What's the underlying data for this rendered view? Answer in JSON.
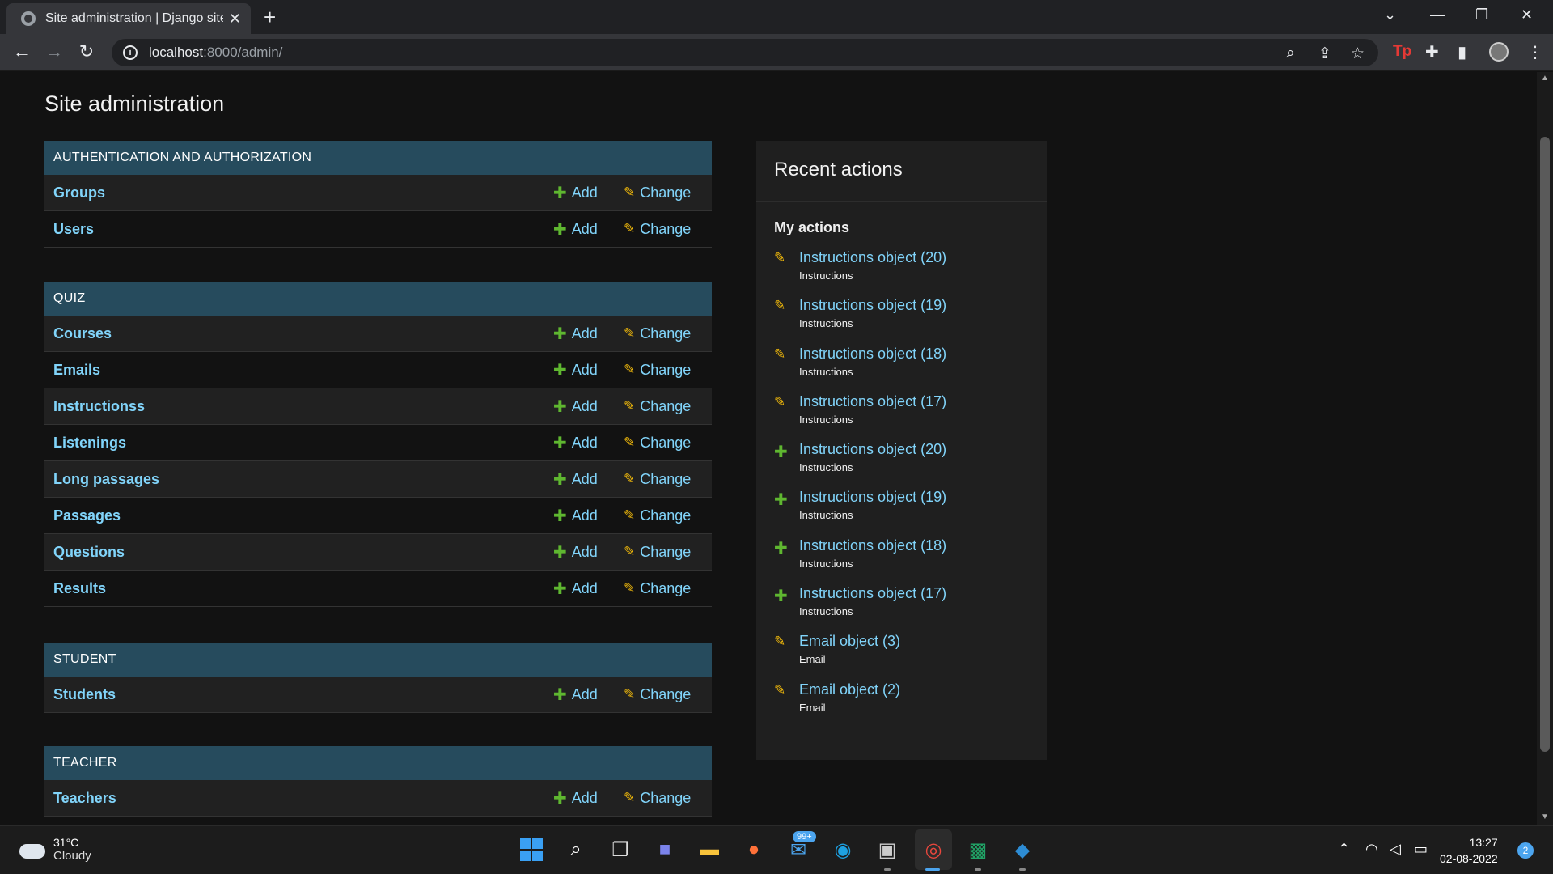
{
  "browser": {
    "tab_title": "Site administration | Django site admin",
    "tab_close": "✕",
    "new_tab": "+",
    "url_host": "localhost",
    "url_path": ":8000/admin/"
  },
  "page": {
    "title": "Site administration",
    "add_label": "Add",
    "change_label": "Change",
    "modules": [
      {
        "caption": "Authentication and Authorization",
        "models": [
          "Groups",
          "Users"
        ]
      },
      {
        "caption": "Quiz",
        "models": [
          "Courses",
          "Emails",
          "Instructionss",
          "Listenings",
          "Long passages",
          "Passages",
          "Questions",
          "Results"
        ]
      },
      {
        "caption": "Student",
        "models": [
          "Students"
        ]
      },
      {
        "caption": "Teacher",
        "models": [
          "Teachers"
        ]
      }
    ]
  },
  "recent": {
    "title": "Recent actions",
    "subtitle": "My actions",
    "actions": [
      {
        "type": "change",
        "object": "Instructions object (20)",
        "model": "Instructions"
      },
      {
        "type": "change",
        "object": "Instructions object (19)",
        "model": "Instructions"
      },
      {
        "type": "change",
        "object": "Instructions object (18)",
        "model": "Instructions"
      },
      {
        "type": "change",
        "object": "Instructions object (17)",
        "model": "Instructions"
      },
      {
        "type": "add",
        "object": "Instructions object (20)",
        "model": "Instructions"
      },
      {
        "type": "add",
        "object": "Instructions object (19)",
        "model": "Instructions"
      },
      {
        "type": "add",
        "object": "Instructions object (18)",
        "model": "Instructions"
      },
      {
        "type": "add",
        "object": "Instructions object (17)",
        "model": "Instructions"
      },
      {
        "type": "change",
        "object": "Email object (3)",
        "model": "Email"
      },
      {
        "type": "change",
        "object": "Email object (2)",
        "model": "Email"
      }
    ]
  },
  "taskbar": {
    "temperature": "31°C",
    "condition": "Cloudy",
    "mail_badge": "99+",
    "time": "13:27",
    "date": "02-08-2022",
    "notifications": "2"
  },
  "colors": {
    "caption_bg": "#264b5d",
    "link": "#81d4fa",
    "add_green": "#5fb730",
    "change_yellow": "#efb80b"
  }
}
